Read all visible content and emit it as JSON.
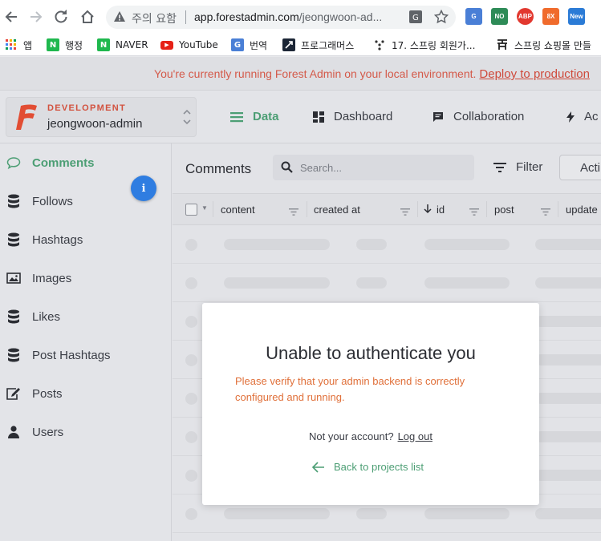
{
  "browser": {
    "security_label": "주의 요함",
    "url_host": "app.forestadmin.com",
    "url_path": "/jeongwoon-ad...",
    "extensions": [
      {
        "name": "google-translate-extension",
        "label": "G",
        "color": "#4a7fd6"
      },
      {
        "name": "no-extension",
        "label": "NO",
        "color": "#2e8b57"
      },
      {
        "name": "adblock-plus-extension",
        "label": "ABP",
        "color": "#e2382f"
      },
      {
        "name": "orange-extension",
        "label": "8X",
        "color": "#f06b2c"
      },
      {
        "name": "new-extension",
        "label": "New",
        "color": "#2b7bd6"
      }
    ]
  },
  "bookmarks": [
    {
      "label": "앱",
      "icon": "apps-grid-icon",
      "color": "#e8453c"
    },
    {
      "label": "행정",
      "icon": "naver-icon",
      "color": "#1fb84e"
    },
    {
      "label": "NAVER",
      "icon": "naver-icon",
      "color": "#1fb84e"
    },
    {
      "label": "YouTube",
      "icon": "youtube-icon",
      "color": "#e62117"
    },
    {
      "label": "번역",
      "icon": "translate-icon",
      "color": "#4a7fd6"
    },
    {
      "label": "프로그래머스",
      "icon": "programmers-icon",
      "color": "#1c2636"
    },
    {
      "label": "17. 스프링 회원가...",
      "icon": "dots-icon",
      "color": "#333333"
    },
    {
      "label": "스프링 쇼핑몰 만들",
      "icon": "ju-icon",
      "color": "#222222"
    }
  ],
  "banner": {
    "message": "You're currently running Forest Admin on your local environment.",
    "link": "Deploy to production"
  },
  "project": {
    "environment": "DEVELOPMENT",
    "name": "jeongwoon-admin"
  },
  "nav": {
    "data": "Data",
    "dashboard": "Dashboard",
    "collaboration": "Collaboration",
    "actions_partial": "Ac"
  },
  "sidebar": {
    "items": [
      {
        "label": "Comments",
        "icon": "comment-icon",
        "active": true
      },
      {
        "label": "Follows",
        "icon": "database-icon",
        "active": false
      },
      {
        "label": "Hashtags",
        "icon": "database-icon",
        "active": false
      },
      {
        "label": "Images",
        "icon": "image-icon",
        "active": false
      },
      {
        "label": "Likes",
        "icon": "database-icon",
        "active": false
      },
      {
        "label": "Post Hashtags",
        "icon": "database-icon",
        "active": false
      },
      {
        "label": "Posts",
        "icon": "edit-icon",
        "active": false
      },
      {
        "label": "Users",
        "icon": "user-icon",
        "active": false
      }
    ],
    "info_glyph": "i"
  },
  "collection": {
    "title": "Comments",
    "search_placeholder": "Search...",
    "filter_label": "Filter",
    "actions_label": "Acti",
    "columns": [
      "content",
      "created at",
      "id",
      "post",
      "update"
    ]
  },
  "modal": {
    "title": "Unable to authenticate you",
    "error": "Please verify that your admin backend is correctly configured and running.",
    "account_question": "Not your account?",
    "logout": "Log out",
    "back": "Back to projects list"
  },
  "colors": {
    "accent_green": "#4c9e74",
    "banner_red": "#d45a4a",
    "error_orange": "#e0703a",
    "info_blue": "#2f7de1"
  }
}
